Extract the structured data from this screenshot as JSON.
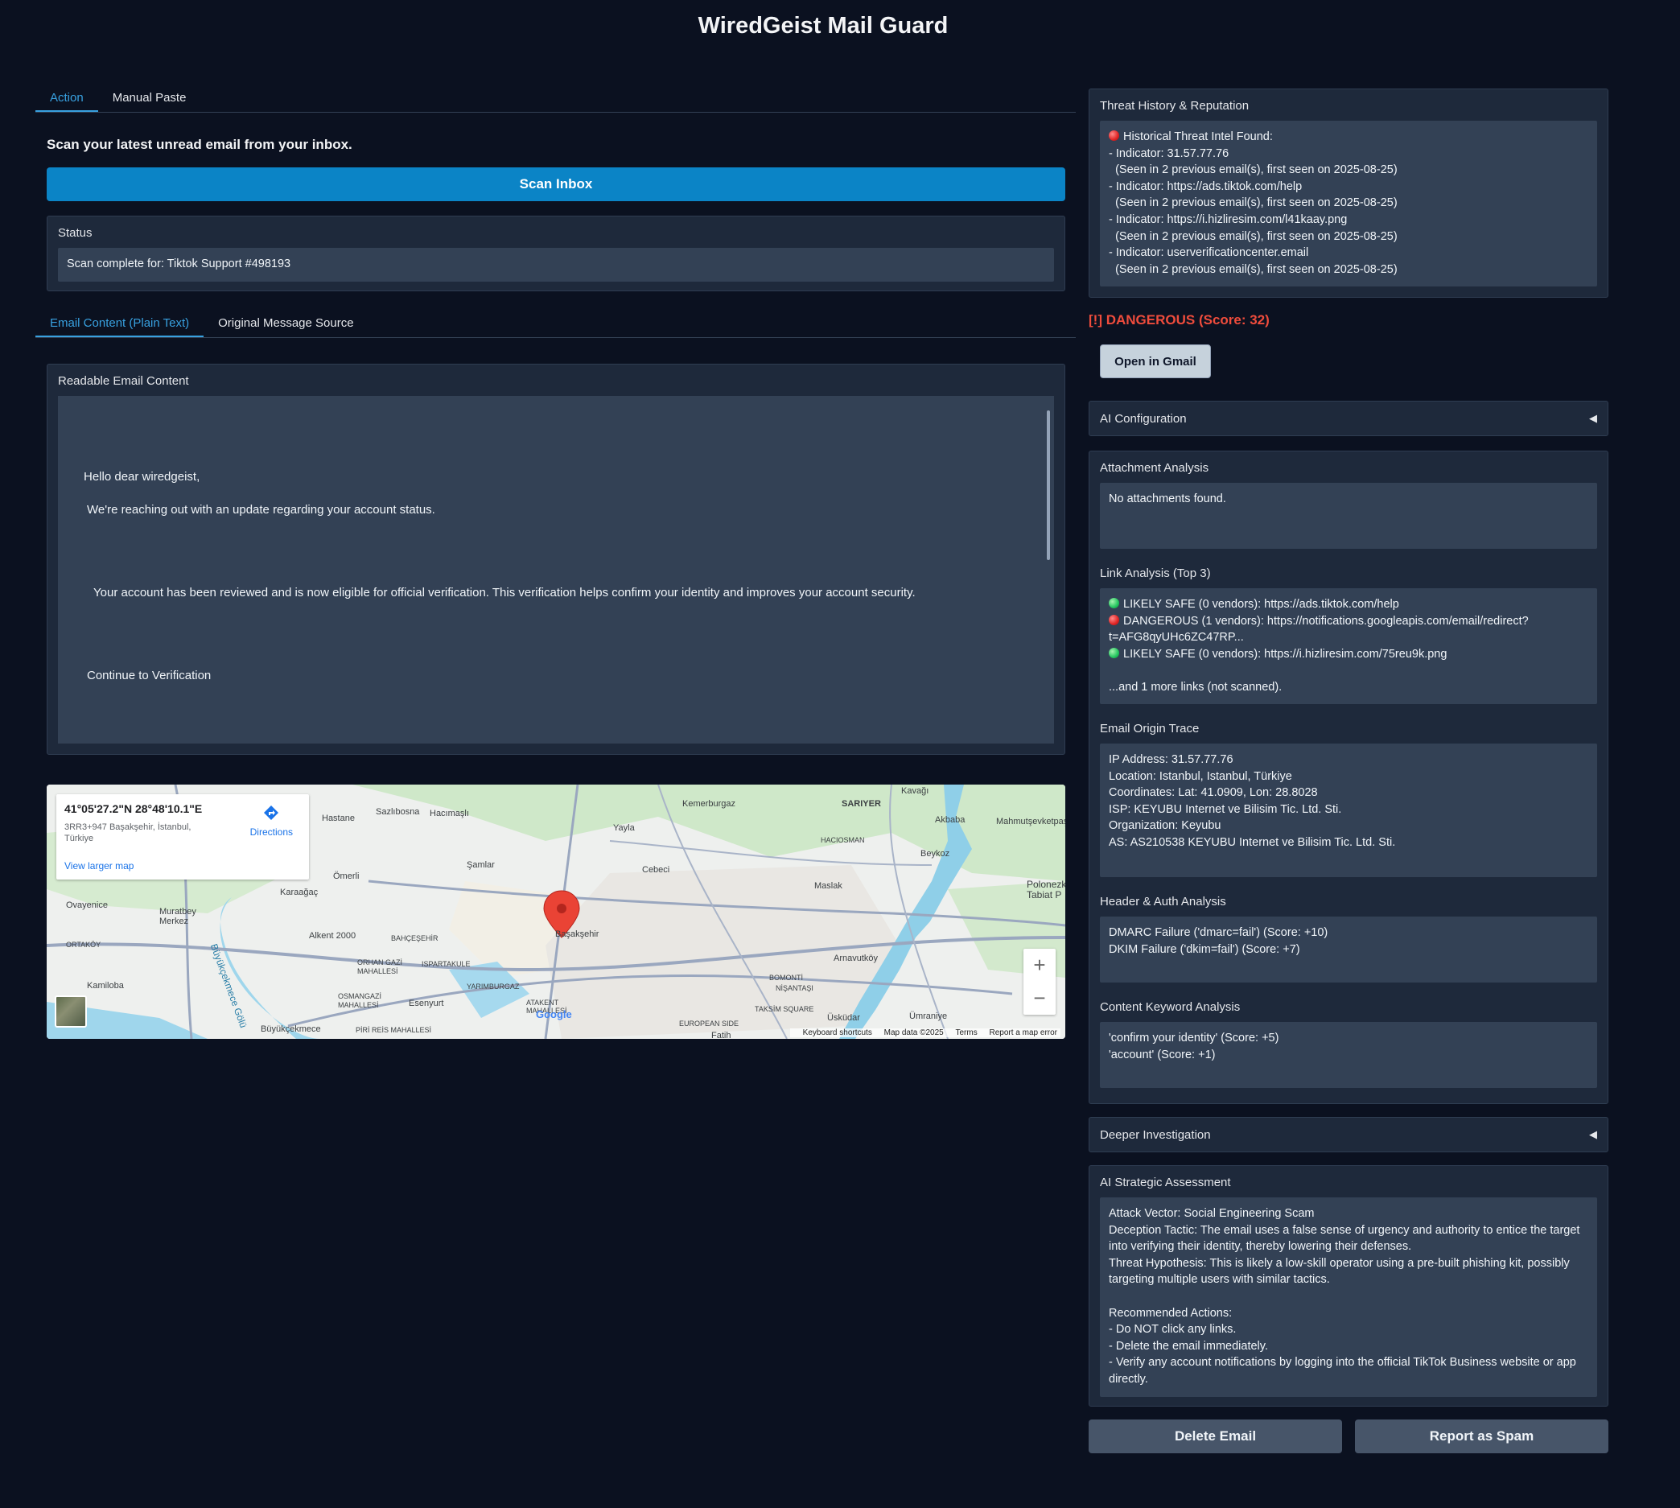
{
  "app": {
    "title": "WiredGeist Mail Guard"
  },
  "top_tabs": [
    "Action",
    "Manual Paste"
  ],
  "scan": {
    "heading": "Scan your latest unread email from your inbox.",
    "button": "Scan Inbox"
  },
  "status": {
    "label": "Status",
    "value": "Scan complete for: Tiktok Support #498193"
  },
  "content_tabs": [
    "Email Content (Plain Text)",
    "Original Message Source"
  ],
  "email": {
    "label": "Readable Email Content",
    "lines": [
      "Hello dear wiredgeist,",
      "We're reaching out with an update regarding your account status.",
      "Your account has been reviewed and is now eligible for official verification. This verification helps confirm your identity and improves your account security.",
      "Continue to Verification"
    ]
  },
  "map": {
    "coords": "41°05'27.2\"N 28°48'10.1\"E",
    "address": "3RR3+947 Başakşehir, İstanbul, Türkiye",
    "directions": "Directions",
    "larger_map": "View larger map",
    "footer": [
      "Keyboard shortcuts",
      "Map data ©2025",
      "Terms",
      "Report a map error"
    ],
    "labels": [
      "Hastane",
      "Sazlıbosna",
      "Hacımaşlı",
      "Kemerburgaz",
      "SARIYER",
      "Kavağı",
      "Akbaba",
      "Mahmutşevketpaşa",
      "Yayla",
      "HACIOSMAN",
      "Beykoz",
      "Şamlar",
      "Cebeci",
      "Ömerli",
      "Karaağaç",
      "Maslak",
      "Ovayenice",
      "Muratbey Merkez",
      "Alkent 2000",
      "BAHÇEŞEHİR",
      "Başakşehir",
      "ORTAKÖY",
      "ORHAN GAZİ MAHALLESİ",
      "ISPARTAKULE",
      "Arnavutköy",
      "Kamiloba",
      "YARIMBURGAZ",
      "BOMONTİ",
      "NİŞANTAŞI",
      "OSMANGAZİ MAHALLESİ",
      "Esenyurt",
      "ATAKENT MAHALLESİ",
      "TAKSİM SQUARE",
      "Üsküdar",
      "Ümraniye",
      "Büyükçekmece",
      "PİRİ REİS MAHALLESİ",
      "EUROPEAN SIDE",
      "Fatih",
      "Büyükçekmece Gölü",
      "Polonezköy Tabiat P",
      "Google"
    ]
  },
  "threat": {
    "label": "Threat History & Reputation",
    "header": "Historical Threat Intel Found:",
    "lines": [
      "- Indicator: 31.57.77.76",
      "  (Seen in 2 previous email(s), first seen on 2025-08-25)",
      "- Indicator: https://ads.tiktok.com/help",
      "  (Seen in 2 previous email(s), first seen on 2025-08-25)",
      "- Indicator: https://i.hizliresim.com/l41kaay.png",
      "  (Seen in 2 previous email(s), first seen on 2025-08-25)",
      "- Indicator: userverificationcenter.email",
      "  (Seen in 2 previous email(s), first seen on 2025-08-25)"
    ]
  },
  "verdict": "[!] DANGEROUS (Score: 32)",
  "gmail_button": "Open in Gmail",
  "ai_config": "AI Configuration",
  "attachment": {
    "label": "Attachment Analysis",
    "value": "No attachments found."
  },
  "links": {
    "label": "Link Analysis (Top 3)",
    "items": [
      {
        "status": "green",
        "text": "LIKELY SAFE (0 vendors): https://ads.tiktok.com/help"
      },
      {
        "status": "red",
        "text": "DANGEROUS (1 vendors): https://notifications.googleapis.com/email/redirect?t=AFG8qyUHc6ZC47RP..."
      },
      {
        "status": "green",
        "text": "LIKELY SAFE (0 vendors): https://i.hizliresim.com/75reu9k.png"
      }
    ],
    "more": "...and 1 more links (not scanned)."
  },
  "origin": {
    "label": "Email Origin Trace",
    "lines": [
      "IP Address: 31.57.77.76",
      "Location: Istanbul, Istanbul, Türkiye",
      "Coordinates: Lat: 41.0909, Lon: 28.8028",
      "ISP: KEYUBU Internet ve Bilisim Tic. Ltd. Sti.",
      "Organization: Keyubu",
      "AS: AS210538 KEYUBU Internet ve Bilisim Tic. Ltd. Sti."
    ]
  },
  "header_auth": {
    "label": "Header & Auth Analysis",
    "lines": [
      "DMARC Failure ('dmarc=fail') (Score: +10)",
      "DKIM Failure ('dkim=fail') (Score: +7)"
    ]
  },
  "keywords": {
    "label": "Content Keyword Analysis",
    "lines": [
      "'confirm your identity' (Score: +5)",
      "'account' (Score: +1)"
    ]
  },
  "deeper": "Deeper Investigation",
  "ai_assessment": {
    "label": "AI Strategic Assessment",
    "text": "Attack Vector: Social Engineering Scam\nDeception Tactic: The email uses a false sense of urgency and authority to entice the target into verifying their identity, thereby lowering their defenses.\nThreat Hypothesis: This is likely a low-skill operator using a pre-built phishing kit, possibly targeting multiple users with similar tactics.\n\nRecommended Actions:\n- Do NOT click any links.\n- Delete the email immediately.\n- Verify any account notifications by logging into the official TikTok Business website or app directly."
  },
  "actions": {
    "delete": "Delete Email",
    "spam": "Report as Spam"
  },
  "colors": {
    "accent": "#0b84c6",
    "danger": "#ef4c3c",
    "background": "#0b1120",
    "panel": "#1e293b"
  }
}
